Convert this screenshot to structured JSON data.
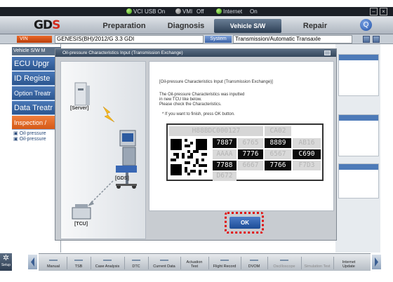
{
  "statusbar": {
    "vci": "VCI",
    "usb": "USB On",
    "vmi": "VMI",
    "vmi_state": "Off",
    "internet": "Internet",
    "internet_state": "On"
  },
  "nav": {
    "logo_a": "GD",
    "logo_b": "S",
    "tabs": [
      "Preparation",
      "Diagnosis",
      "Vehicle S/W Management",
      "Repair"
    ],
    "active_tab": "Vehicle S/W Management",
    "help_label": "Q"
  },
  "vehicle": {
    "vin_label": "VIN",
    "vehicle_text": "GENESIS(BH)/2012/G 3.3 GDI",
    "system_label": "System",
    "system_text": "Transmission/Automatic Transaxle"
  },
  "leftpanel": {
    "header": "Vehicle S/W M",
    "items": [
      "ECU Upgr",
      "ID Registe",
      "Option Treatr",
      "Data Treatr",
      "Inspection /"
    ],
    "subitems": [
      "Oil-pressure",
      "Oil-pressure"
    ]
  },
  "modal": {
    "title": "Oil-pressure Characteristics Input (Transmission Exchange)",
    "diagram": {
      "server": "[Server]",
      "gds": "[GDS]",
      "tcu": "[TCU]"
    },
    "message": {
      "heading": "[Oil-pressure Characteristics Input (Transmission Exchange)]",
      "line1": "The Oil-pressure Characteristics was inputted",
      "line2": "in new TCU like below.",
      "line3": "Please check the Characteristics.",
      "line4": "* If you want to finish, press OK button."
    },
    "codes": {
      "head1": "H88BDC000127",
      "head2": "CA02",
      "row1": [
        "7887",
        "6765",
        "8889",
        "AB16"
      ],
      "row2": [
        "AAAA",
        "7776",
        "6567",
        "C690"
      ],
      "row3": [
        "7788",
        "6667",
        "7766",
        "F7D3"
      ],
      "row4": [
        "D672"
      ]
    },
    "ok": "OK"
  },
  "toolbar": {
    "setup": "Setup",
    "buttons": [
      "Manual",
      "TSB",
      "Case Analysis",
      "DTC",
      "Current Data",
      "Actuation Test",
      "Flight Record",
      "DVOM",
      "Oscilloscope",
      "Simulation Test",
      "Internet Update"
    ]
  },
  "colors": {
    "accent_blue": "#2c568f",
    "accent_orange": "#d55a18",
    "highlight_red": "#e01010"
  }
}
